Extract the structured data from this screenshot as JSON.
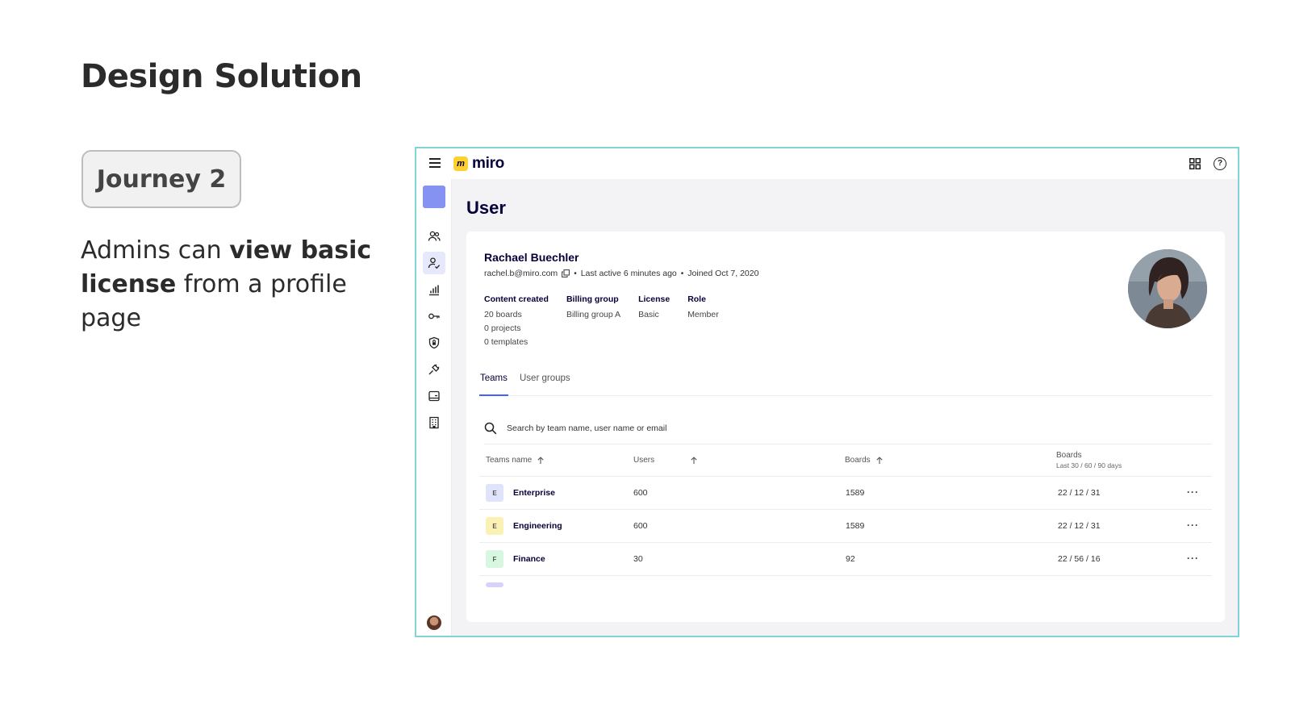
{
  "slide": {
    "title": "Design Solution",
    "journey": "Journey 2",
    "desc_part1": "Admins can ",
    "desc_bold1": "view basic license",
    "desc_part2": " from a profile page"
  },
  "app": {
    "logo_text": "miro",
    "logo_mark": "m",
    "help_glyph": "?",
    "page_title": "User",
    "user": {
      "name": "Rachael Buechler",
      "email": "rachel.b@miro.com",
      "last_active": "Last active 6 minutes ago",
      "joined": "Joined Oct 7, 2020",
      "separator": "•"
    },
    "stats": {
      "content_label": "Content created",
      "content_values": [
        "20 boards",
        "0 projects",
        "0 templates"
      ],
      "billing_label": "Billing group",
      "billing_value": "Billing group A",
      "license_label": "License",
      "license_value": "Basic",
      "role_label": "Role",
      "role_value": "Member"
    },
    "tabs": [
      "Teams",
      "User groups"
    ],
    "search_placeholder": "Search by team name, user name or email",
    "table": {
      "headers": {
        "team": "Teams name",
        "users": "Users",
        "boards": "Boards",
        "boards_recent": "Boards",
        "boards_recent_sub": "Last 30 / 60 / 90 days"
      },
      "rows": [
        {
          "badge": "E",
          "badge_color": "#dfe4fb",
          "name": "Enterprise",
          "users": "600",
          "boards": "1589",
          "recent": "22 / 12 / 31"
        },
        {
          "badge": "E",
          "badge_color": "#fcf1b4",
          "name": "Engineering",
          "users": "600",
          "boards": "1589",
          "recent": "22 / 12 / 31"
        },
        {
          "badge": "F",
          "badge_color": "#d8f7e1",
          "name": "Finance",
          "users": "30",
          "boards": "92",
          "recent": "22 / 56 / 16"
        }
      ],
      "more_glyph": "···"
    },
    "colors": {
      "accent": "#4262ff",
      "org_square": "#8592f1",
      "logo_yellow": "#ffd02f",
      "frame_border": "#7fd4d8"
    }
  }
}
